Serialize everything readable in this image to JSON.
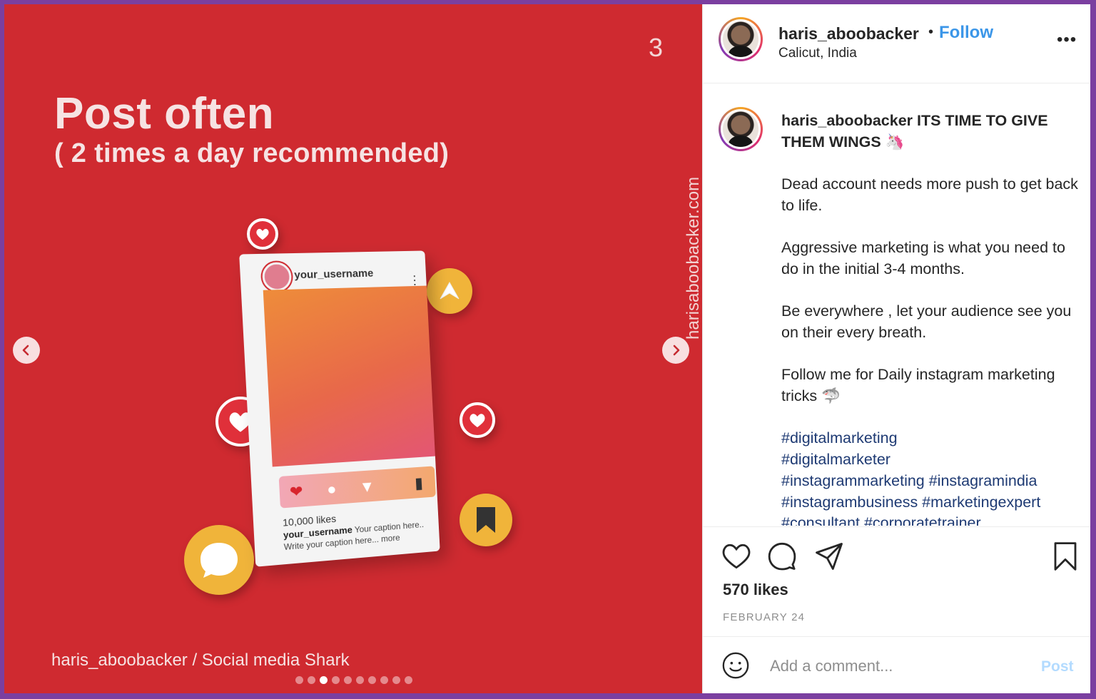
{
  "media": {
    "slide_number": "3",
    "headline": "Post often",
    "subheadline": "( 2 times a day recommended)",
    "vertical_text": "harisaboobacker.com",
    "credit": "haris_aboobacker / Social media Shark",
    "dots_total": 10,
    "dots_active_index": 2,
    "mockup": {
      "username": "your_username",
      "likes": "10,000 likes",
      "caption_user": "your_username",
      "caption_text": "Your caption here.. Write your caption here... more"
    }
  },
  "header": {
    "username": "haris_aboobacker",
    "separator": "•",
    "follow_label": "Follow",
    "location": "Calicut, India",
    "more_label": "•••"
  },
  "caption": {
    "username": "haris_aboobacker",
    "title": "ITS TIME TO GIVE THEM WINGS 🦄",
    "paragraphs": [
      "Dead account needs more push to get back to life.",
      "Aggressive marketing is what you need to do in the initial 3-4 months.",
      "Be everywhere , let your audience see you on their every breath.",
      "Follow me for Daily instagram marketing tricks 🦈"
    ],
    "hashtags": "#digitalmarketing\n#digitalmarketer\n#instagrammarketing #instagramindia\n#instagrambusiness #marketingexpert\n#consultant #corporatetrainer"
  },
  "actions": {
    "likes": "570 likes",
    "date": "FEBRUARY 24"
  },
  "comment_box": {
    "placeholder": "Add a comment...",
    "post_label": "Post"
  },
  "colors": {
    "media_bg": "#cf2a30",
    "follow": "#3b96e8",
    "hashtag": "#1e3a73",
    "post_disabled": "#b3dbff"
  }
}
